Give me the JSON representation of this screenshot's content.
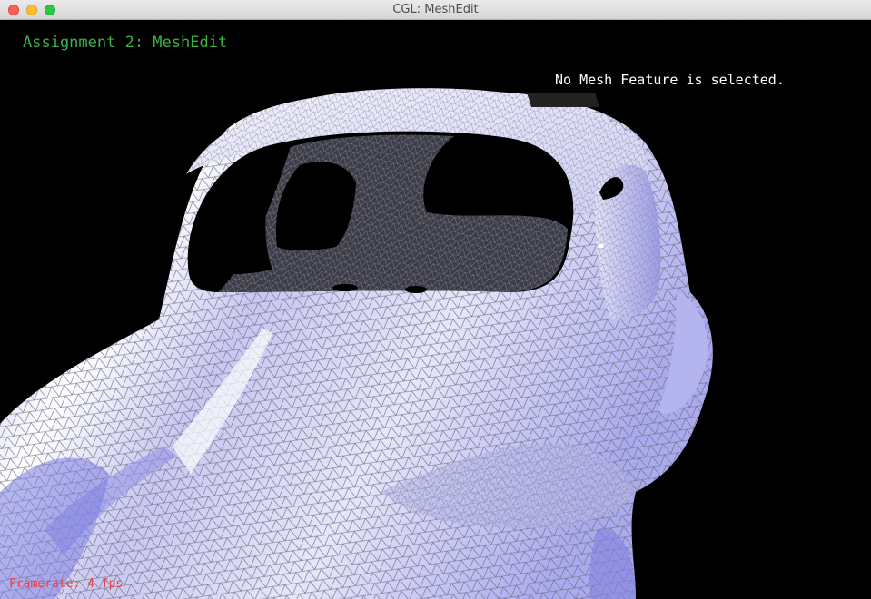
{
  "window": {
    "title": "CGL: MeshEdit",
    "controls": {
      "close": "close-icon",
      "minimize": "minimize-icon",
      "zoom": "zoom-icon"
    }
  },
  "hud": {
    "assignment_title": "Assignment 2: MeshEdit",
    "selection_status": "No Mesh Feature is selected.",
    "framerate": "Framerate: 4 fps"
  },
  "colors": {
    "background": "#000000",
    "title_text": "#3bb143",
    "status_text": "#ffffff",
    "framerate_text": "#e64545",
    "mesh_fill": "#c9c9f3",
    "mesh_shade": "#8c8ce6",
    "wire": "#ffffff"
  }
}
